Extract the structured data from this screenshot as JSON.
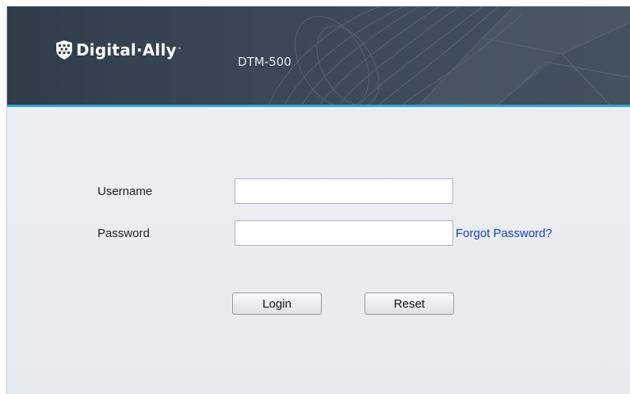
{
  "brand": {
    "logo_text": "Digital·Ally",
    "trademark": "°",
    "product_name": "DTM-500",
    "icon": "shield-logo-icon",
    "banner_color": "#3a4858",
    "accent_color": "#2aa8dc"
  },
  "form": {
    "username": {
      "label": "Username",
      "value": "",
      "placeholder": ""
    },
    "password": {
      "label": "Password",
      "value": "",
      "placeholder": ""
    },
    "forgot_password_label": "Forgot Password?",
    "login_label": "Login",
    "reset_label": "Reset",
    "link_color": "#1a3fc8"
  }
}
